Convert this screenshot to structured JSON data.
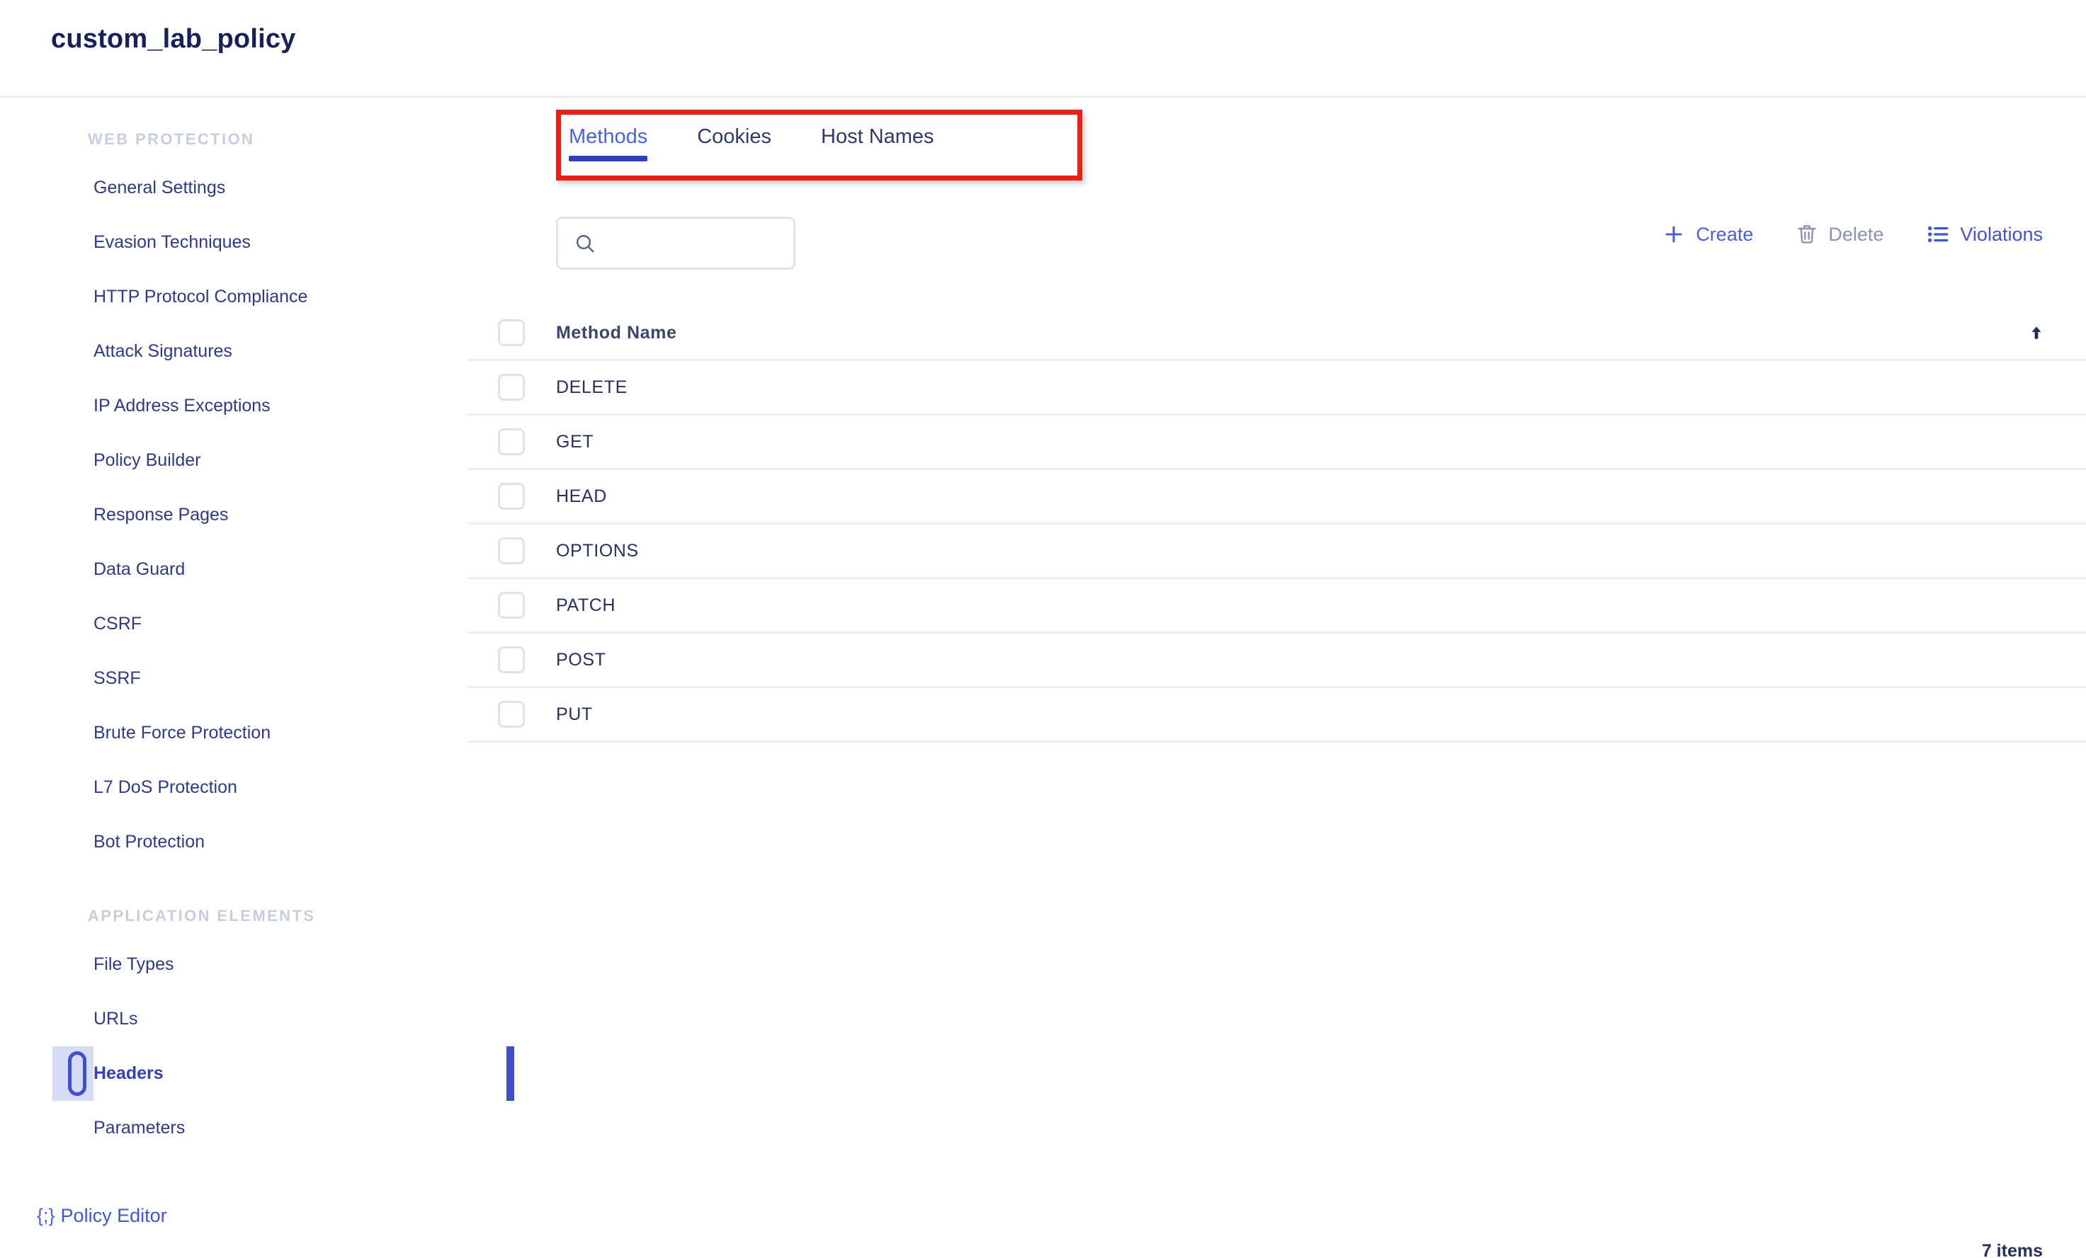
{
  "header": {
    "title": "custom_lab_policy"
  },
  "sidebar": {
    "groups": [
      {
        "label": "WEB PROTECTION",
        "items": [
          {
            "label": "General Settings",
            "selected": false
          },
          {
            "label": "Evasion Techniques",
            "selected": false
          },
          {
            "label": "HTTP Protocol Compliance",
            "selected": false
          },
          {
            "label": "Attack Signatures",
            "selected": false
          },
          {
            "label": "IP Address Exceptions",
            "selected": false
          },
          {
            "label": "Policy Builder",
            "selected": false
          },
          {
            "label": "Response Pages",
            "selected": false
          },
          {
            "label": "Data Guard",
            "selected": false
          },
          {
            "label": "CSRF",
            "selected": false
          },
          {
            "label": "SSRF",
            "selected": false
          },
          {
            "label": "Brute Force Protection",
            "selected": false
          },
          {
            "label": "L7 DoS Protection",
            "selected": false
          },
          {
            "label": "Bot Protection",
            "selected": false
          }
        ]
      },
      {
        "label": "APPLICATION ELEMENTS",
        "items": [
          {
            "label": "File Types",
            "selected": false
          },
          {
            "label": "URLs",
            "selected": false
          },
          {
            "label": "Headers",
            "selected": true
          },
          {
            "label": "Parameters",
            "selected": false
          }
        ]
      }
    ],
    "policy_editor": {
      "icon": "code-braces-icon",
      "brace": "{;}",
      "label": "Policy Editor"
    }
  },
  "main": {
    "tabs": [
      {
        "label": "Methods",
        "active": true
      },
      {
        "label": "Cookies",
        "active": false
      },
      {
        "label": "Host Names",
        "active": false
      }
    ],
    "highlight": {
      "color": "#f41b10",
      "target": "tabbar"
    },
    "search": {
      "icon": "search-icon",
      "value": "",
      "placeholder": ""
    },
    "actions": [
      {
        "label": "Create",
        "icon": "plus-icon",
        "state": "enabled"
      },
      {
        "label": "Delete",
        "icon": "trash-icon",
        "state": "disabled"
      },
      {
        "label": "Violations",
        "icon": "list-icon",
        "state": "enabled"
      }
    ],
    "table": {
      "columns": [
        "Method Name"
      ],
      "sort": {
        "column": "Method Name",
        "direction": "asc",
        "icon": "arrow-up-icon"
      },
      "rows": [
        {
          "method_name": "DELETE",
          "checked": false
        },
        {
          "method_name": "GET",
          "checked": false
        },
        {
          "method_name": "HEAD",
          "checked": false
        },
        {
          "method_name": "OPTIONS",
          "checked": false
        },
        {
          "method_name": "PATCH",
          "checked": false
        },
        {
          "method_name": "POST",
          "checked": false
        },
        {
          "method_name": "PUT",
          "checked": false
        }
      ]
    },
    "footer": {
      "item_count": "7 items"
    }
  },
  "colors": {
    "accent_blue": "#3f4fd1",
    "link_blue": "#3d55e0",
    "title_navy": "#16205c",
    "highlight_red": "#f41b10",
    "selected_bg": "#d7dcf5",
    "disabled_gray": "#8b92b4"
  }
}
